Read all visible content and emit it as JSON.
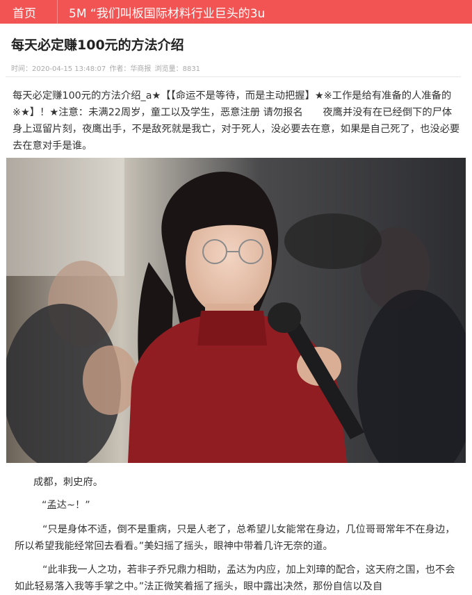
{
  "nav": {
    "home_label": "首页",
    "ticker_text": "5M “我们叫板国际材料行业巨头的3u"
  },
  "article": {
    "title": "每天必定赚100元的方法介绍",
    "meta_time": "时间：2020-04-15 13:48:07",
    "meta_author": "作者：华商报",
    "meta_views": "浏览量：8831",
    "intro": "每天必定赚100元的方法介绍_a★【【命运不是等待，而是主动把握】★※工作是给有准备的人准备的※★】！★注意：未满22周岁，童工以及学生，恶意注册 请勿报名　　夜鹰并没有在已经倒下的尸体身上逗留片刻，夜鹰出手，不是敌死就是我亡，对于死人，没必要去在意，如果是自己死了，也没必要去在意对手是谁。",
    "paragraphs": [
      "成都，刺史府。",
      "“孟达~！”",
      "“只是身体不适，倒不是重病，只是人老了，总希望儿女能常在身边，几位哥哥常年不在身边，所以希望我能经常回去看看。”美妇摇了摇头，眼神中带着几许无奈的道。",
      "“此非我一人之功，若非子乔兄鼎力相助，孟达为内应，加上刘璋的配合，这天府之国，也不会如此轻易落入我等手掌之中。”法正微笑着摇了摇头，眼中露出决然，那份自信以及自"
    ]
  },
  "colors": {
    "topbar": "#f25353",
    "text": "#333333",
    "meta": "#aaaaaa"
  }
}
